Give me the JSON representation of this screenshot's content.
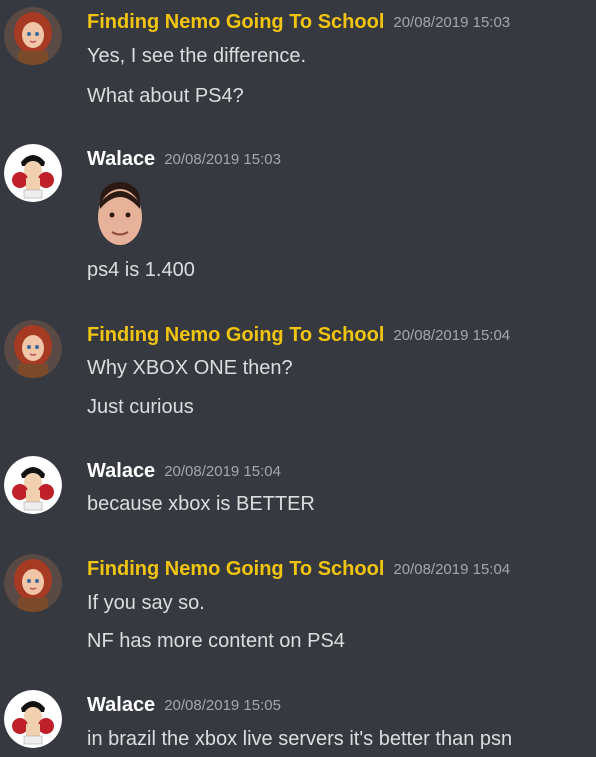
{
  "users": {
    "nemo": {
      "name": "Finding Nemo Going To School",
      "color": "#f1c40f"
    },
    "walace": {
      "name": "Walace",
      "color": "#ffffff"
    }
  },
  "messages": [
    {
      "author": "Finding Nemo Going To School",
      "timestamp": "20/08/2019 15:03",
      "lines": [
        "Yes, I see the difference.",
        "What about PS4?"
      ]
    },
    {
      "author": "Walace",
      "timestamp": "20/08/2019 15:03",
      "emoji": "face-emoji",
      "lines": [
        "ps4 is 1.400"
      ]
    },
    {
      "author": "Finding Nemo Going To School",
      "timestamp": "20/08/2019 15:04",
      "lines": [
        "Why XBOX ONE then?",
        "Just curious"
      ]
    },
    {
      "author": "Walace",
      "timestamp": "20/08/2019 15:04",
      "lines": [
        "because xbox is BETTER"
      ]
    },
    {
      "author": "Finding Nemo Going To School",
      "timestamp": "20/08/2019 15:04",
      "lines": [
        "If you say so.",
        "NF has more content on PS4"
      ]
    },
    {
      "author": "Walace",
      "timestamp": "20/08/2019 15:05",
      "lines": [
        "in brazil the xbox live servers it's better than psn"
      ]
    }
  ],
  "colors": {
    "background": "#36393f",
    "text": "#dcddde",
    "timestamp": "#a3a6aa"
  }
}
